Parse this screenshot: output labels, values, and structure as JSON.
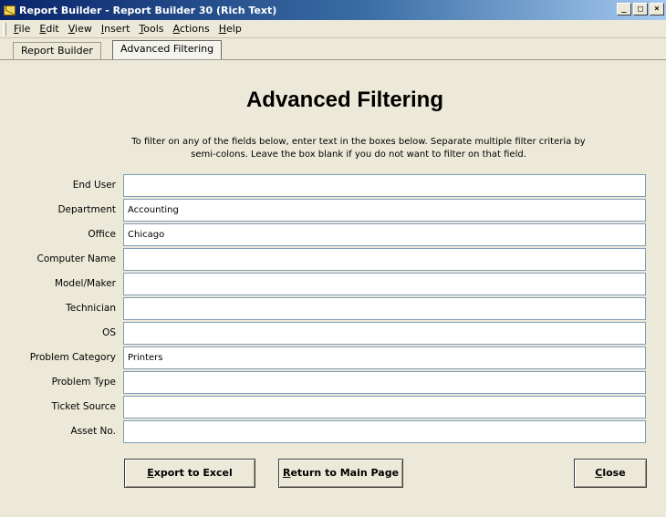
{
  "window": {
    "title": "Report Builder - Report Builder 30 (Rich Text)",
    "controls": [
      "_",
      "□",
      "×"
    ]
  },
  "menu": [
    {
      "label": "File",
      "accel": "F"
    },
    {
      "label": "Edit",
      "accel": "E"
    },
    {
      "label": "View",
      "accel": "V"
    },
    {
      "label": "Insert",
      "accel": "I"
    },
    {
      "label": "Tools",
      "accel": "T"
    },
    {
      "label": "Actions",
      "accel": "A"
    },
    {
      "label": "Help",
      "accel": "H"
    }
  ],
  "tabs": [
    {
      "label": "Report Builder",
      "active": false
    },
    {
      "label": "Advanced Filtering",
      "active": true
    }
  ],
  "page": {
    "heading": "Advanced Filtering",
    "instructions_line1": "To filter on any of the fields below, enter text in the boxes below. Separate multiple filter criteria by",
    "instructions_line2": "semi-colons. Leave the box blank if you do not want to filter on that field."
  },
  "fields": [
    {
      "label": "End User",
      "value": ""
    },
    {
      "label": "Department",
      "value": "Accounting"
    },
    {
      "label": "Office",
      "value": "Chicago"
    },
    {
      "label": "Computer Name",
      "value": ""
    },
    {
      "label": "Model/Maker",
      "value": ""
    },
    {
      "label": "Technician",
      "value": ""
    },
    {
      "label": "OS",
      "value": ""
    },
    {
      "label": "Problem Category",
      "value": "Printers"
    },
    {
      "label": "Problem Type",
      "value": ""
    },
    {
      "label": "Ticket Source",
      "value": ""
    },
    {
      "label": "Asset No.",
      "value": ""
    }
  ],
  "buttons": {
    "export": {
      "accel": "E",
      "rest": "xport to Excel"
    },
    "return": {
      "accel": "R",
      "rest": "eturn to Main Page"
    },
    "close": {
      "accel": "C",
      "rest": "lose"
    }
  }
}
